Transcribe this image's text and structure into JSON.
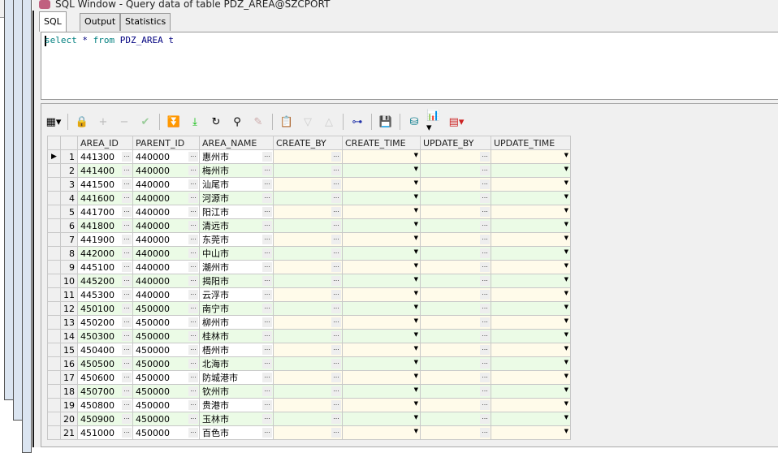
{
  "window": {
    "title": "SQL Window - Query data of table PDZ_AREA@SZCPORT"
  },
  "tabs": [
    {
      "label": "SQL",
      "active": true
    },
    {
      "label": "Output"
    },
    {
      "label": "Statistics"
    }
  ],
  "editor": {
    "sql_keyword1": "select",
    "sql_star": " * ",
    "sql_keyword2": "from",
    "sql_table": " PDZ_AREA t"
  },
  "toolbar": [
    "grid-layout-icon",
    "lock-icon",
    "add-record-icon",
    "delete-record-icon",
    "post-changes-icon",
    "fetch-next-icon",
    "fetch-last-icon",
    "refresh-icon",
    "find-icon",
    "clear-icon",
    "query-by-example-icon",
    "previous-record-icon",
    "next-record-icon",
    "tree-view-icon",
    "save-icon",
    "export-icon",
    "chart-icon",
    "table-export-icon"
  ],
  "grid": {
    "columns": [
      "AREA_ID",
      "PARENT_ID",
      "AREA_NAME",
      "CREATE_BY",
      "CREATE_TIME",
      "UPDATE_BY",
      "UPDATE_TIME"
    ],
    "rows": [
      [
        "441300",
        "440000",
        "惠州市"
      ],
      [
        "441400",
        "440000",
        "梅州市"
      ],
      [
        "441500",
        "440000",
        "汕尾市"
      ],
      [
        "441600",
        "440000",
        "河源市"
      ],
      [
        "441700",
        "440000",
        "阳江市"
      ],
      [
        "441800",
        "440000",
        "清远市"
      ],
      [
        "441900",
        "440000",
        "东莞市"
      ],
      [
        "442000",
        "440000",
        "中山市"
      ],
      [
        "445100",
        "440000",
        "潮州市"
      ],
      [
        "445200",
        "440000",
        "揭阳市"
      ],
      [
        "445300",
        "440000",
        "云浮市"
      ],
      [
        "450100",
        "450000",
        "南宁市"
      ],
      [
        "450200",
        "450000",
        "柳州市"
      ],
      [
        "450300",
        "450000",
        "桂林市"
      ],
      [
        "450400",
        "450000",
        "梧州市"
      ],
      [
        "450500",
        "450000",
        "北海市"
      ],
      [
        "450600",
        "450000",
        "防城港市"
      ],
      [
        "450700",
        "450000",
        "钦州市"
      ],
      [
        "450800",
        "450000",
        "贵港市"
      ],
      [
        "450900",
        "450000",
        "玉林市"
      ],
      [
        "451000",
        "450000",
        "百色市"
      ]
    ],
    "current_row": 1
  }
}
